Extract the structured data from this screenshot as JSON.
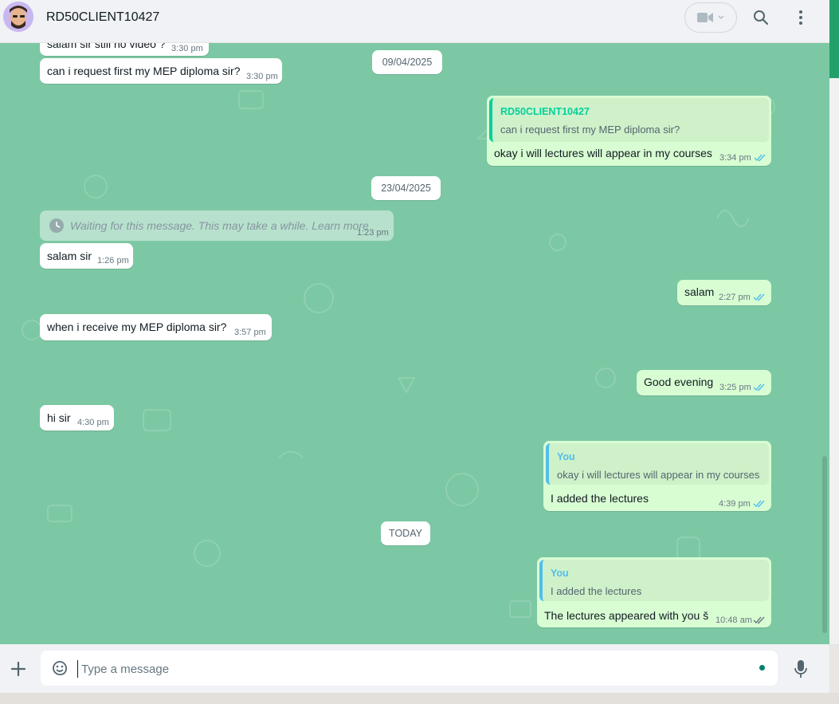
{
  "header": {
    "contact_name": "RD50CLIENT10427",
    "icons": [
      "avatar",
      "video-call-icon",
      "chevron-down-icon",
      "search-icon",
      "menu-icon"
    ]
  },
  "messages": {
    "m1": {
      "text": "salam sir still no video ?",
      "time": "3:30 pm"
    },
    "m2": {
      "text": "can i request first my MEP diploma sir?",
      "time": "3:30 pm"
    },
    "date1": "09/04/2025",
    "m3": {
      "quote_author": "RD50CLIENT10427",
      "quote_text": "can i request first my MEP diploma sir?",
      "text": "okay i will lectures will appear in my courses",
      "time": "3:34 pm"
    },
    "date2": "23/04/2025",
    "m4": {
      "text": "Waiting for this message. This may take a while. ",
      "link": "Learn more",
      "time": "1:23 pm"
    },
    "m5": {
      "text": "salam sir",
      "time": "1:26 pm"
    },
    "m6": {
      "text": "salam",
      "time": "2:27 pm"
    },
    "m7": {
      "text": "when i receive my MEP diploma  sir?",
      "time": "3:57 pm"
    },
    "m8": {
      "text": "Good evening",
      "time": "3:25 pm"
    },
    "m9": {
      "text": "hi sir",
      "time": "4:30 pm"
    },
    "m10": {
      "quote_author": "You",
      "quote_text": "okay i will lectures will appear in my courses",
      "text": "I added the lectures",
      "time": "4:39 pm"
    },
    "date3": "TODAY",
    "m11": {
      "quote_author": "You",
      "quote_text": "I added the lectures",
      "text": "The lectures appeared with you š",
      "time": "10:48 am"
    }
  },
  "composer": {
    "placeholder": "Type a message",
    "icons": [
      "plus-icon",
      "sticker-icon",
      "mic-icon"
    ]
  },
  "colors": {
    "wallpaper": "#7dc8a4",
    "outgoing_bubble": "#d9fdd3",
    "incoming_bubble": "#ffffff",
    "read_ticks": "#53bdeb",
    "quote_other_bar": "#06cf9c",
    "quote_you_bar": "#53bdeb",
    "accent": "#21a06a"
  }
}
